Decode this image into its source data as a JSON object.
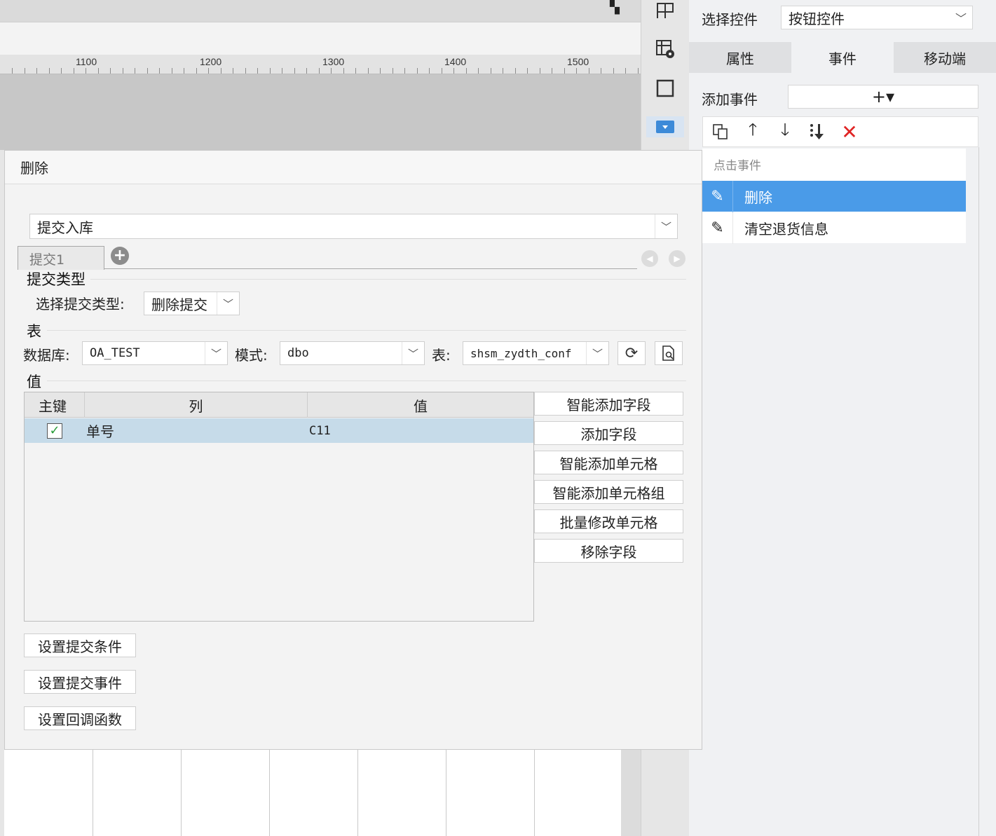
{
  "ruler": {
    "labels": [
      "1100",
      "1200",
      "1300",
      "1400",
      "1500"
    ]
  },
  "strip": {
    "icons": [
      "layout-icon",
      "table-settings-icon",
      "frame-icon",
      "dropdown-widget-icon"
    ]
  },
  "right_panel": {
    "select_label": "选择控件",
    "select_value": "按钮控件",
    "tabs": [
      "属性",
      "事件",
      "移动端"
    ],
    "active_tab": "事件",
    "add_event_label": "添加事件",
    "add_event_button": "+▾",
    "toolbar_icons": [
      "copy-icon",
      "move-up-icon",
      "move-down-icon",
      "move-bottom-icon",
      "delete-icon"
    ],
    "event_group": "点击事件",
    "events": [
      {
        "label": "删除",
        "selected": true
      },
      {
        "label": "清空退货信息",
        "selected": false
      }
    ],
    "selected_color": "#4a9be8"
  },
  "dialog": {
    "title": "删除",
    "action_type": "提交入库",
    "subtab": "提交1",
    "section_submit_type": "提交类型",
    "submit_type_label": "选择提交类型:",
    "submit_type_value": "删除提交",
    "section_table": "表",
    "db_label": "数据库:",
    "db_value": "OA_TEST",
    "schema_label": "模式:",
    "schema_value": "dbo",
    "table_label": "表:",
    "table_value": "shsm_zydth_conf",
    "section_value": "值",
    "grid": {
      "headers": [
        "主键",
        "列",
        "值"
      ],
      "rows": [
        {
          "key": true,
          "column": "单号",
          "value": "C11"
        }
      ]
    },
    "side_buttons": [
      "智能添加字段",
      "添加字段",
      "智能添加单元格",
      "智能添加单元格组",
      "批量修改单元格",
      "移除字段"
    ],
    "bottom_buttons": [
      "设置提交条件",
      "设置提交事件",
      "设置回调函数"
    ]
  }
}
